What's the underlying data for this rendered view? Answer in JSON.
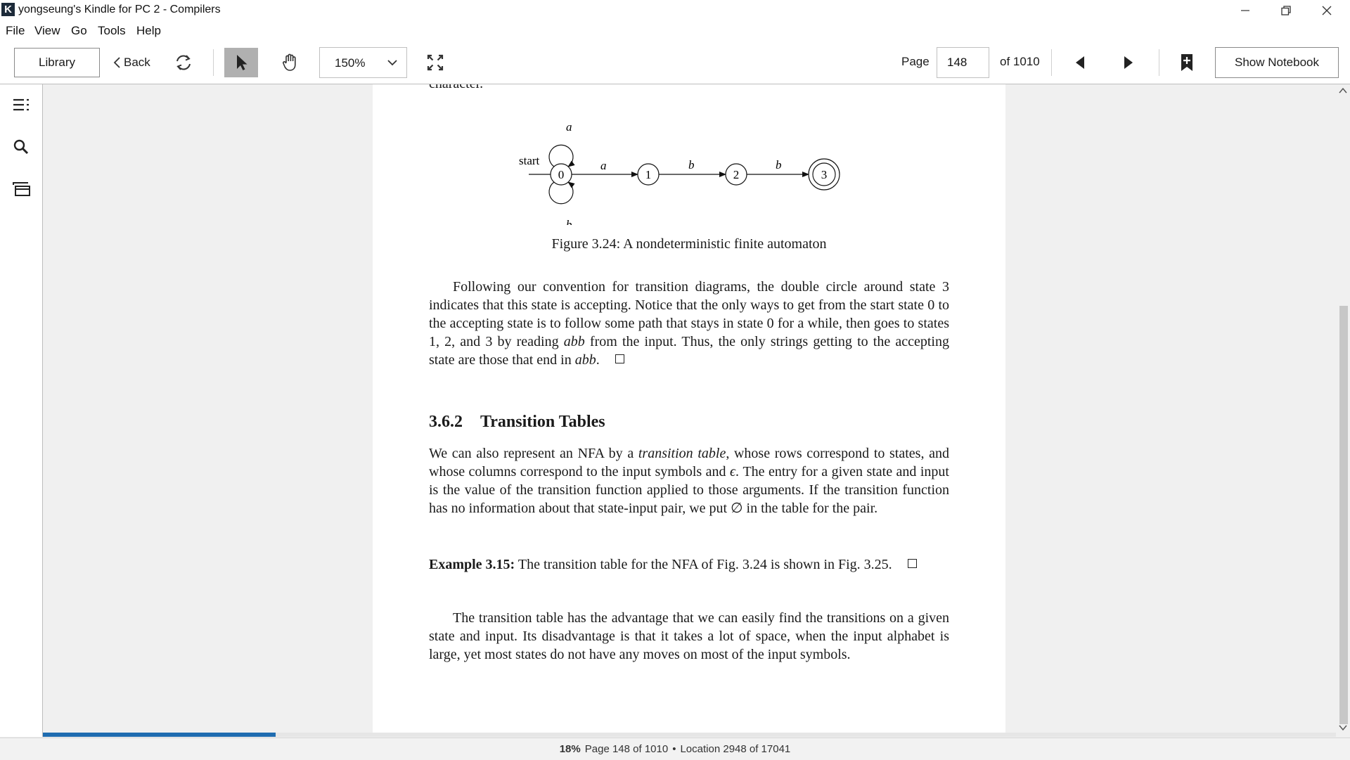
{
  "window": {
    "title": "yongseung's Kindle for PC 2 - Compilers",
    "app_icon": "kindle-k-icon",
    "controls": [
      "minimize-icon",
      "restore-icon",
      "close-icon"
    ]
  },
  "menu": [
    "File",
    "View",
    "Go",
    "Tools",
    "Help"
  ],
  "toolbar": {
    "library_label": "Library",
    "back_label": "Back",
    "zoom_value": "150%",
    "page_label": "Page",
    "page_value": "148",
    "of_total": "of 1010",
    "notebook_label": "Show Notebook",
    "icons": [
      "sync-icon",
      "select-pointer-icon",
      "hand-pan-icon",
      "fullscreen-icon",
      "prev-page-icon",
      "next-page-icon",
      "bookmark-add-icon"
    ]
  },
  "sidebar": {
    "icons": [
      "toc-icon",
      "search-icon",
      "flashcards-icon"
    ]
  },
  "figure": {
    "start_label": "start",
    "states": [
      "0",
      "1",
      "2",
      "3"
    ],
    "loop_top_label": "a",
    "loop_bottom_label": "b",
    "edge_labels": [
      "a",
      "b",
      "b"
    ]
  },
  "content": {
    "cut_line": "character.",
    "caption": "Figure 3.24: A nondeterministic finite automaton",
    "para1": {
      "t1": "Following our convention for transition diagrams, the double circle around state 3 indicates that this state is accepting. Notice that the only ways to get from the start state 0 to the accepting state is to follow some path that stays in state 0 for a while, then goes to states 1, 2, and 3 by reading ",
      "t2": "abb",
      "t3": " from the input. Thus, the only strings getting to the accepting state are those that end in ",
      "t4": "abb",
      "t5": "."
    },
    "section_number": "3.6.2",
    "section_title": "Transition Tables",
    "para2": {
      "t1": "We can also represent an NFA by a ",
      "t2": "transition table",
      "t3": ", whose rows correspond to states, and whose columns correspond to the input symbols and ",
      "t4": "ϵ",
      "t5": ". The entry for a given state and input is the value of the transition function applied to those arguments. If the transition function has no information about that state-input pair, we put ∅ in the table for the pair."
    },
    "example": {
      "label": "Example 3.15:",
      "text": " The transition table for the NFA of Fig. 3.24 is shown in Fig. 3.25."
    },
    "para3": "The transition table has the advantage that we can easily find the transitions on a given state and input. Its disadvantage is that it takes a lot of space, when the input alphabet is large, yet most states do not have any moves on most of the input symbols."
  },
  "status": {
    "percent": "18%",
    "page_text": "Page 148 of 1010",
    "separator": "•",
    "location_text": "Location 2948 of 17041"
  },
  "progress": {
    "fraction": 0.18
  },
  "colors": {
    "progress": "#1f6cb0",
    "select_tool_active": "#b0b0b0"
  }
}
